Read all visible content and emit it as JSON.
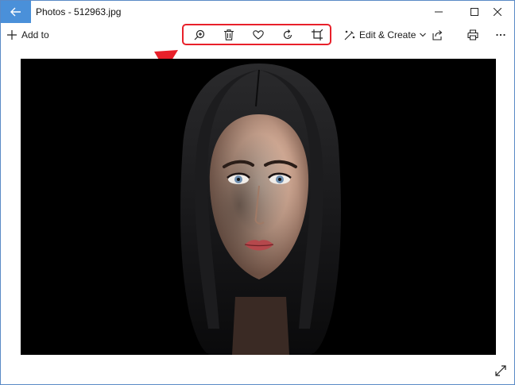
{
  "window": {
    "title": "Photos - 512963.jpg"
  },
  "toolbar": {
    "add_to_label": "Add to",
    "edit_create_label": "Edit & Create"
  },
  "icons": {
    "back": "back-arrow-icon",
    "minimize": "minimize-icon",
    "maximize": "maximize-icon",
    "close": "close-icon",
    "add": "plus-icon",
    "zoom": "zoom-in-icon",
    "delete": "trash-icon",
    "favorite": "heart-icon",
    "rotate": "rotate-icon",
    "crop": "crop-icon",
    "edit": "edit-create-icon",
    "share": "share-icon",
    "print": "print-icon",
    "more": "more-icon",
    "expand": "expand-icon"
  },
  "colors": {
    "accent": "#4a90d9",
    "highlight": "#e8202a",
    "photo_background": "#000000"
  }
}
